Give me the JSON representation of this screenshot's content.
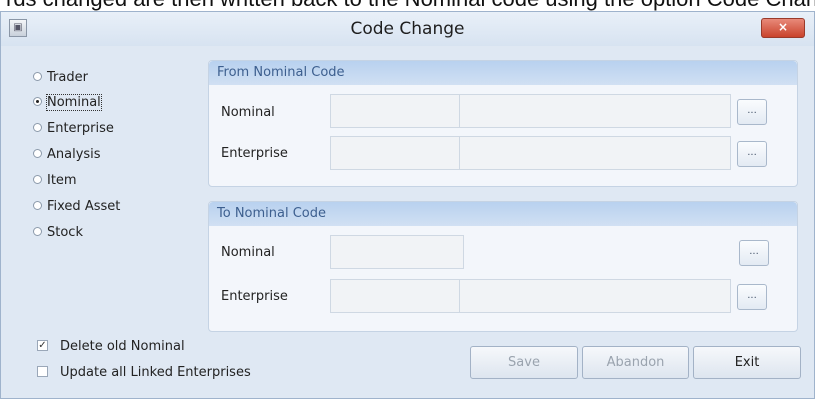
{
  "top_text": "rds changed are then written back to the Nominal code using the option Code Change",
  "window": {
    "title": "Code Change",
    "close_label": "×",
    "app_icon": "app-icon"
  },
  "code_type": {
    "options": [
      "Trader",
      "Nominal",
      "Enterprise",
      "Analysis",
      "Item",
      "Fixed Asset",
      "Stock"
    ],
    "selected": "Nominal"
  },
  "from_panel": {
    "title": "From Nominal Code",
    "nominal_label": "Nominal",
    "enterprise_label": "Enterprise",
    "nominal_code": "",
    "nominal_desc": "",
    "enterprise_code": "",
    "enterprise_desc": "",
    "lookup_label": "..."
  },
  "to_panel": {
    "title": "To Nominal Code",
    "nominal_label": "Nominal",
    "enterprise_label": "Enterprise",
    "nominal_code": "",
    "enterprise_code": "",
    "enterprise_desc": "",
    "lookup_label": "..."
  },
  "options": {
    "delete_old_label": "Delete old Nominal",
    "delete_old_checked": true,
    "update_linked_label": "Update all Linked Enterprises",
    "update_linked_checked": false
  },
  "buttons": {
    "save": "Save",
    "abandon": "Abandon",
    "exit": "Exit"
  }
}
